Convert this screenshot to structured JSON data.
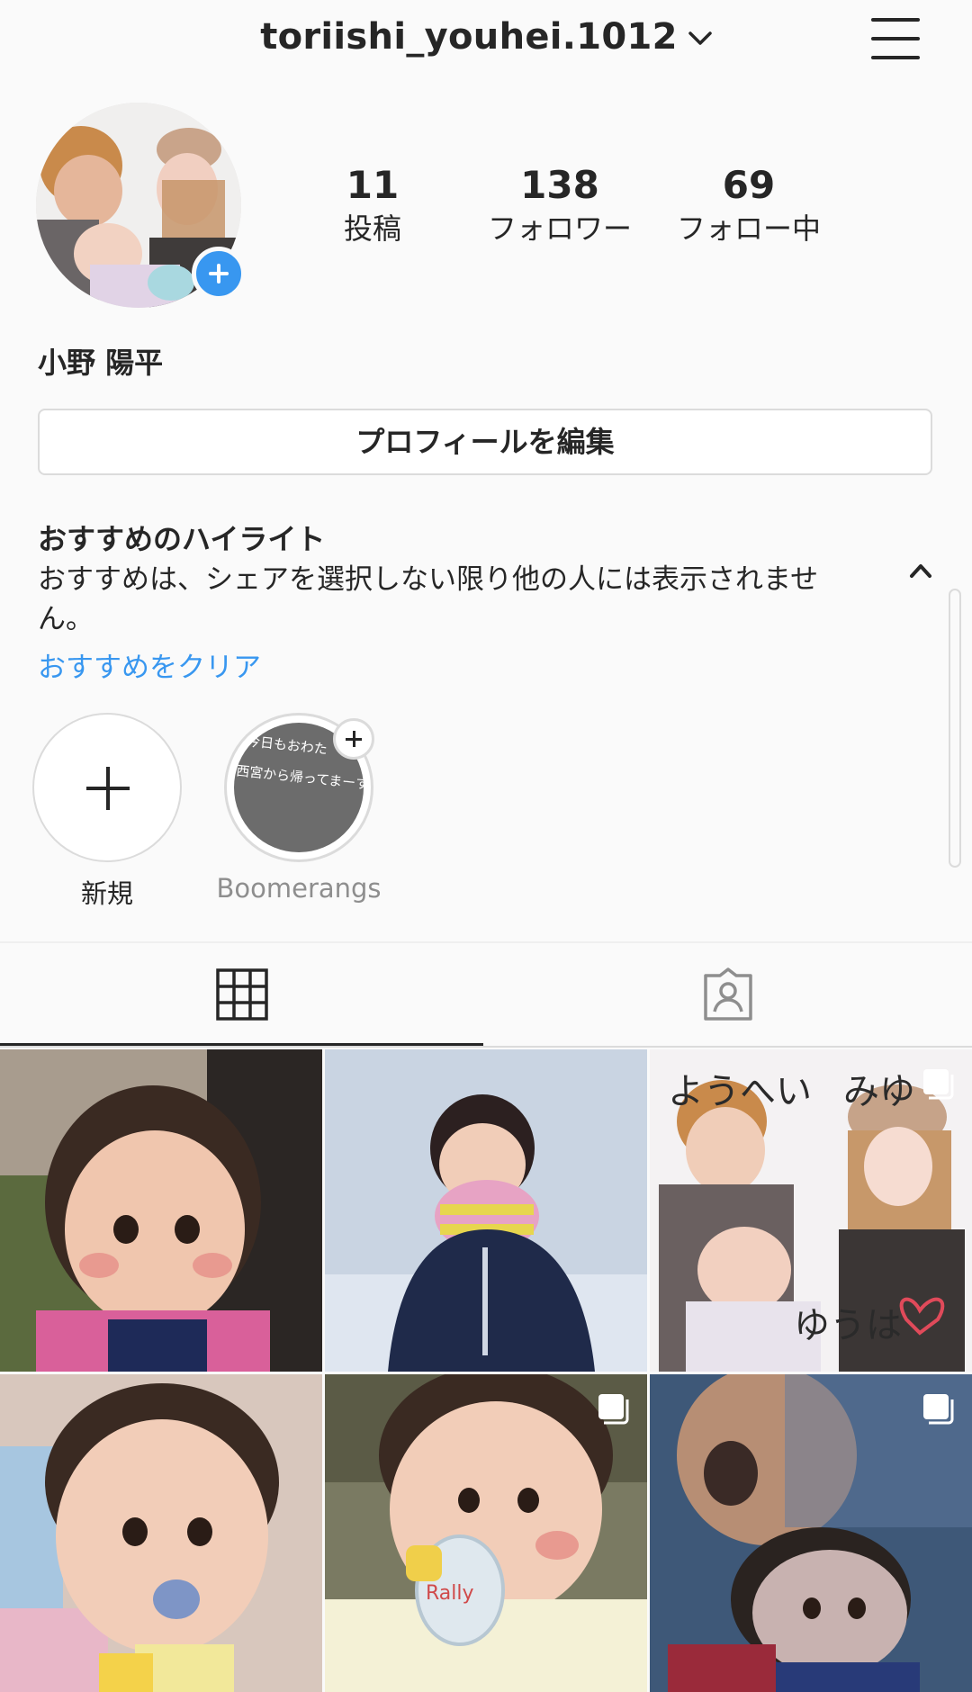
{
  "header": {
    "username": "toriishi_youhei.1012",
    "chevron_icon": "chevron-down-icon",
    "menu_icon": "hamburger-menu-icon"
  },
  "profile": {
    "stats": [
      {
        "value": "11",
        "label": "投稿"
      },
      {
        "value": "138",
        "label": "フォロワー"
      },
      {
        "value": "69",
        "label": "フォロー中"
      }
    ],
    "full_name": "小野 陽平",
    "edit_button": "プロフィールを編集"
  },
  "highlights": {
    "title": "おすすめのハイライト",
    "description": "おすすめは、シェアを選択しない限り他の人には表示されません。",
    "clear_link": "おすすめをクリア",
    "items": [
      {
        "label": "新規"
      },
      {
        "label": "Boomerangs",
        "thumb_text_1": "今日もおわた",
        "thumb_text_2": "西宮から帰ってまーす"
      }
    ]
  },
  "tabs": [
    {
      "name": "grid",
      "icon": "grid-icon",
      "active": true
    },
    {
      "name": "tagged",
      "icon": "tagged-person-icon",
      "active": false
    }
  ],
  "photo_text": {
    "tile3_label_left": "ようへい",
    "tile3_label_right": "みゆ",
    "tile3_label_bottom": "ゆうは",
    "tile5_toy": "Rally"
  },
  "colors": {
    "accent_blue": "#3897f0",
    "text": "#262626",
    "border": "#dbdbdb",
    "background": "#fafafa"
  }
}
